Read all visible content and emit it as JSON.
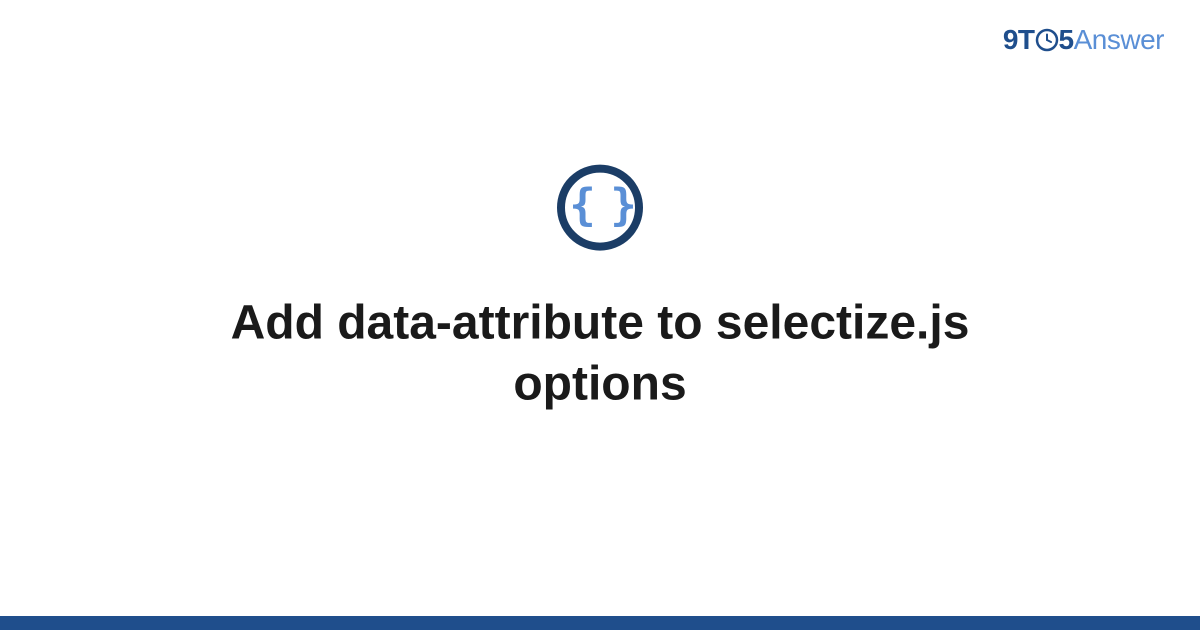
{
  "brand": {
    "prefix": "9T",
    "middle": "5",
    "suffix": "Answer"
  },
  "icon": {
    "glyph": "{ }",
    "name": "code-braces-icon"
  },
  "title": "Add data-attribute to selectize.js options",
  "colors": {
    "brand_dark": "#1f4e8c",
    "brand_light": "#5a8fd6",
    "icon_ring": "#1b3d66",
    "text": "#1a1a1a"
  }
}
